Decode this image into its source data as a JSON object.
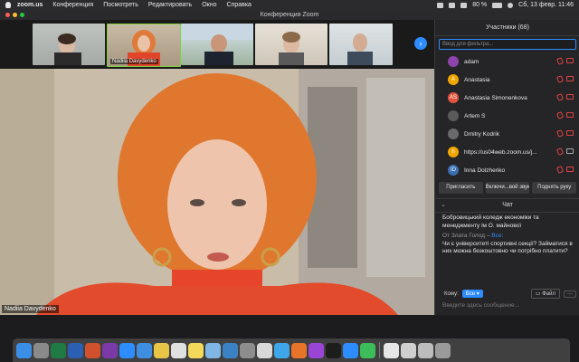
{
  "menubar": {
    "app": "zoom.us",
    "items": [
      "Конференция",
      "Посмотреть",
      "Редактировать",
      "Окно",
      "Справка"
    ],
    "battery": "80 %",
    "datetime": "Сб, 13 февр.  11:46"
  },
  "window": {
    "title": "Конференция Zoom"
  },
  "thumbnails": [
    {
      "label": ""
    },
    {
      "label": "Nadiia Davydenko"
    },
    {
      "label": ""
    },
    {
      "label": ""
    },
    {
      "label": ""
    }
  ],
  "main_video": {
    "name": "Nadiia Davydenko"
  },
  "participants": {
    "header": "Участники (68)",
    "filter_placeholder": "Ввод для фильтра...",
    "list": [
      {
        "initial": "",
        "name": "adam",
        "color": "#8e44ad"
      },
      {
        "initial": "A",
        "name": "Anastasia",
        "color": "#f0a500"
      },
      {
        "initial": "AS",
        "name": "Anastasia Simonenkova",
        "color": "#e2533d"
      },
      {
        "initial": "",
        "name": "Artem S",
        "color": "#5a5a5a"
      },
      {
        "initial": "",
        "name": "Dmitry Kodrik",
        "color": "#6a6a6a"
      },
      {
        "initial": "h",
        "name": "https://us04web.zoom.us/j...",
        "color": "#f0a500"
      },
      {
        "initial": "ID",
        "name": "Inna Dolzhenko",
        "color": "#3a6fb0"
      }
    ],
    "buttons": [
      "Пригласить",
      "Включи...вой звук",
      "Поднять руку"
    ]
  },
  "chat": {
    "header": "Чат",
    "messages": [
      {
        "from": "",
        "to": "",
        "text": "Бобровицький коледж економіки та менеджменту ім О. майнової"
      },
      {
        "from": "От Злата Голод",
        "to": "Все",
        "text": "Чи є університеті спортивні секції? Займатися в них можна безкоштовно чи потрібно платити?"
      }
    ],
    "to_label": "Кому:",
    "to_value": "Все",
    "file_label": "Файл",
    "more_label": "···",
    "input_placeholder": "Введите здесь сообщение..."
  },
  "dock": [
    "finder",
    "launchpad",
    "excel",
    "word",
    "powerpoint",
    "onenote",
    "appstore",
    "onedrive",
    "photos",
    "chrome",
    "notes",
    "preview",
    "keynote",
    "settings",
    "text",
    "safari",
    "firefox",
    "podcasts",
    "tv",
    "zoom",
    "facetime",
    "separator",
    "doc",
    "doc2",
    "doc3",
    "trash"
  ]
}
